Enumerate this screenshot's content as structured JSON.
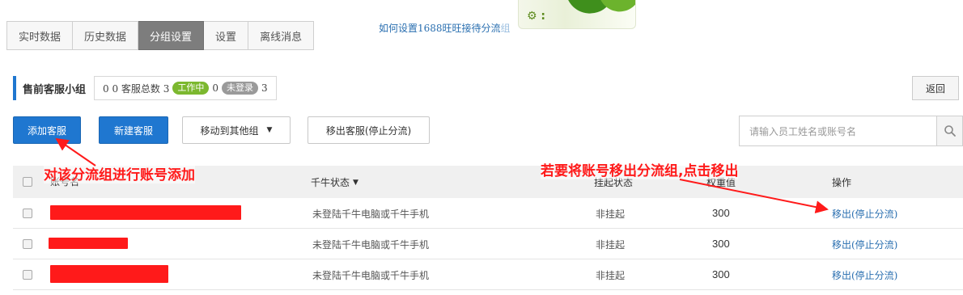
{
  "tabs": [
    {
      "label": "实时数据",
      "active": false
    },
    {
      "label": "历史数据",
      "active": false
    },
    {
      "label": "分组设置",
      "active": true
    },
    {
      "label": "设置",
      "active": false
    },
    {
      "label": "离线消息",
      "active": false
    }
  ],
  "help_link": {
    "text": "如何设置1688旺旺接待分流",
    "tail": "组"
  },
  "group": {
    "name": "售前客服小组",
    "prefix": "0 0 客服总数 3",
    "working_label": "工作中",
    "working_count": "0",
    "offline_label": "未登录",
    "offline_count": "3"
  },
  "back_label": "返回",
  "toolbar": {
    "add_label": "添加客服",
    "new_label": "新建客服",
    "move_label": "移动到其他组",
    "remove_label": "移出客服(停止分流)"
  },
  "search": {
    "placeholder": "请输入员工姓名或账号名"
  },
  "table": {
    "headers": {
      "account": "账号名",
      "qianniu_status": "千牛状态",
      "suspend_status": "挂起状态",
      "weight": "权重值",
      "operation": "操作"
    },
    "rows": [
      {
        "account": "",
        "qianniu_status": "未登陆千牛电脑或千牛手机",
        "suspend_status": "非挂起",
        "weight": "300",
        "operation": "移出(停止分流)"
      },
      {
        "account": "",
        "qianniu_status": "未登陆千牛电脑或千牛手机",
        "suspend_status": "非挂起",
        "weight": "300",
        "operation": "移出(停止分流)"
      },
      {
        "account": "",
        "qianniu_status": "未登陆千牛电脑或千牛手机",
        "suspend_status": "非挂起",
        "weight": "300",
        "operation": "移出(停止分流)"
      }
    ]
  },
  "annotations": {
    "add_note": "对该分流组进行账号添加",
    "remove_note": "若要将账号移出分流组,点击移出"
  },
  "colors": {
    "accent": "#1f77d0",
    "annotation": "#ff1a1a",
    "working": "#7cb82f",
    "link": "#2a6fb0"
  }
}
